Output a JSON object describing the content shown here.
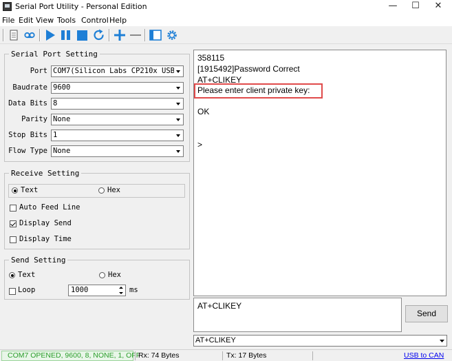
{
  "window": {
    "title": "Serial Port Utility - Personal Edition",
    "minimize": "—",
    "maximize": "☐",
    "close": "✕"
  },
  "menu": {
    "file": "File",
    "edit": "Edit",
    "view": "View",
    "tools": "Tools",
    "control": "Control",
    "help": "Help"
  },
  "toolbar": {
    "icons": [
      "document-icon",
      "record-icon",
      "play-icon",
      "pause-icon",
      "stop-icon",
      "refresh-icon",
      "plus-icon",
      "minus-icon",
      "window-icon",
      "gear-icon"
    ],
    "accent": "#1e7fd6"
  },
  "serial": {
    "title": "Serial Port Setting",
    "port_label": "Port",
    "port_value": "COM7(Silicon Labs CP210x USB",
    "baud_label": "Baudrate",
    "baud_value": "9600",
    "databits_label": "Data Bits",
    "databits_value": "8",
    "parity_label": "Parity",
    "parity_value": "None",
    "stopbits_label": "Stop Bits",
    "stopbits_value": "1",
    "flow_label": "Flow Type",
    "flow_value": "None"
  },
  "receive": {
    "title": "Receive Setting",
    "text_label": "Text",
    "hex_label": "Hex",
    "auto_feed_label": "Auto Feed Line",
    "auto_feed": false,
    "display_send_label": "Display Send",
    "display_send": true,
    "display_time_label": "Display Time",
    "display_time": false
  },
  "send": {
    "title": "Send Setting",
    "text_label": "Text",
    "hex_label": "Hex",
    "loop_label": "Loop",
    "loop": false,
    "interval_value": "1000",
    "interval_unit": "ms"
  },
  "output": {
    "lines": [
      "358115",
      "[1915492]Password Correct",
      "AT+CLIKEY",
      "Please enter client private key:",
      "OK",
      ">"
    ],
    "highlight_color": "#e04a4a"
  },
  "input": {
    "text": "AT+CLIKEY",
    "send_label": "Send",
    "history_value": "AT+CLIKEY"
  },
  "status": {
    "connection": "COM7 OPENED, 9600, 8, NONE, 1, OFF",
    "connection_color": "#2a9d2a",
    "rx": "Rx: 74 Bytes",
    "tx": "Tx: 17 Bytes",
    "link": "USB to CAN"
  }
}
